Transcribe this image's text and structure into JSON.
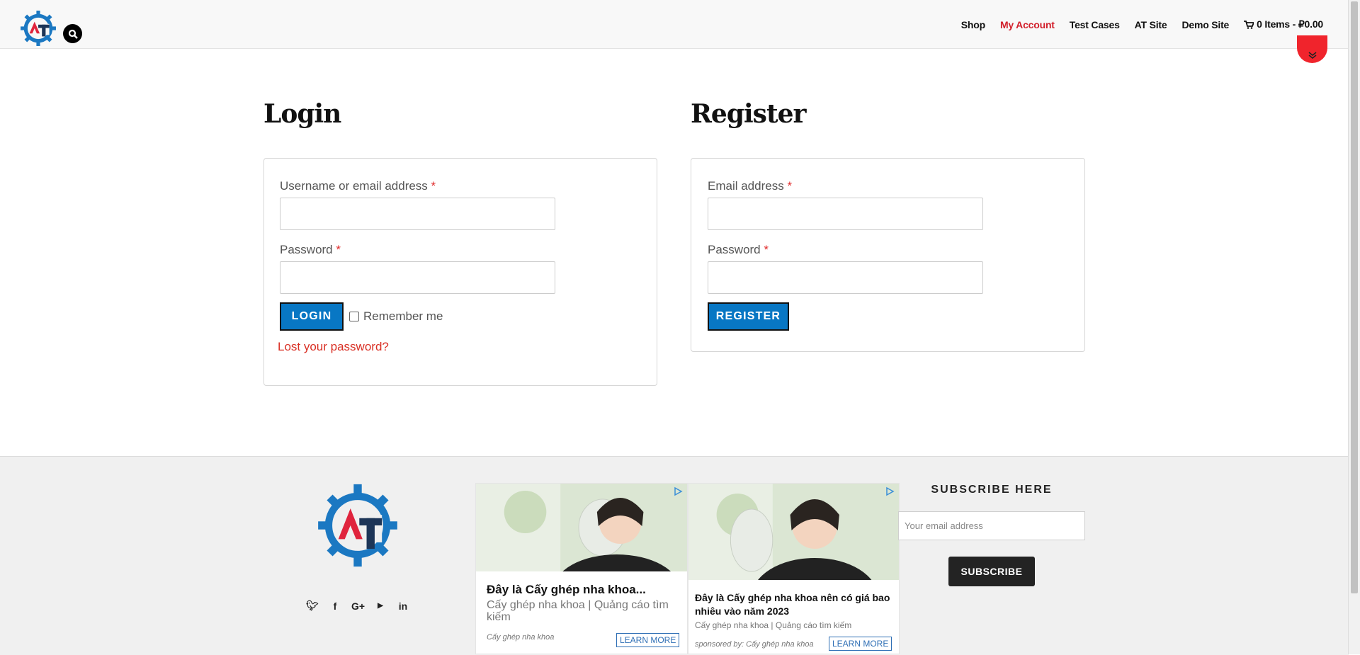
{
  "header": {
    "nav": [
      {
        "label": "Shop"
      },
      {
        "label": "My Account",
        "active": true
      },
      {
        "label": "Test Cases"
      },
      {
        "label": "AT Site"
      },
      {
        "label": "Demo Site"
      }
    ],
    "cart_label": "0 Items - ₽0.00"
  },
  "login": {
    "title": "Login",
    "username_label": "Username or email address",
    "password_label": "Password",
    "required_mark": "*",
    "button_label": "LOGIN",
    "remember_label": "Remember me",
    "lost_password": "Lost your password?"
  },
  "register": {
    "title": "Register",
    "email_label": "Email address",
    "password_label": "Password",
    "required_mark": "*",
    "button_label": "REGISTER"
  },
  "footer": {
    "social_icons": [
      "twitter-icon",
      "facebook-icon",
      "google-plus-icon",
      "youtube-icon",
      "linkedin-icon"
    ],
    "ad1": {
      "title": "Đây là Cấy ghép nha khoa...",
      "subtitle": "Cấy ghép nha khoa | Quảng cáo tìm kiếm",
      "sponsor": "Cấy ghép nha khoa",
      "cta": "LEARN MORE"
    },
    "ad2": {
      "title": "Đây là Cấy ghép nha khoa nên có giá bao nhiêu vào năm 2023",
      "subtitle": "Cấy ghép nha khoa | Quảng cáo tìm kiếm",
      "sponsor": "sponsored by: Cấy ghép nha khoa",
      "cta": "LEARN MORE"
    },
    "subscribe": {
      "title": "SUBSCRIBE HERE",
      "email_placeholder": "Your email address",
      "button_label": "SUBSCRIBE"
    }
  },
  "colors": {
    "accent_red": "#d21f2b",
    "button_blue": "#0877c4",
    "logo_blue": "#1b78c2",
    "logo_navy": "#1d3557"
  }
}
